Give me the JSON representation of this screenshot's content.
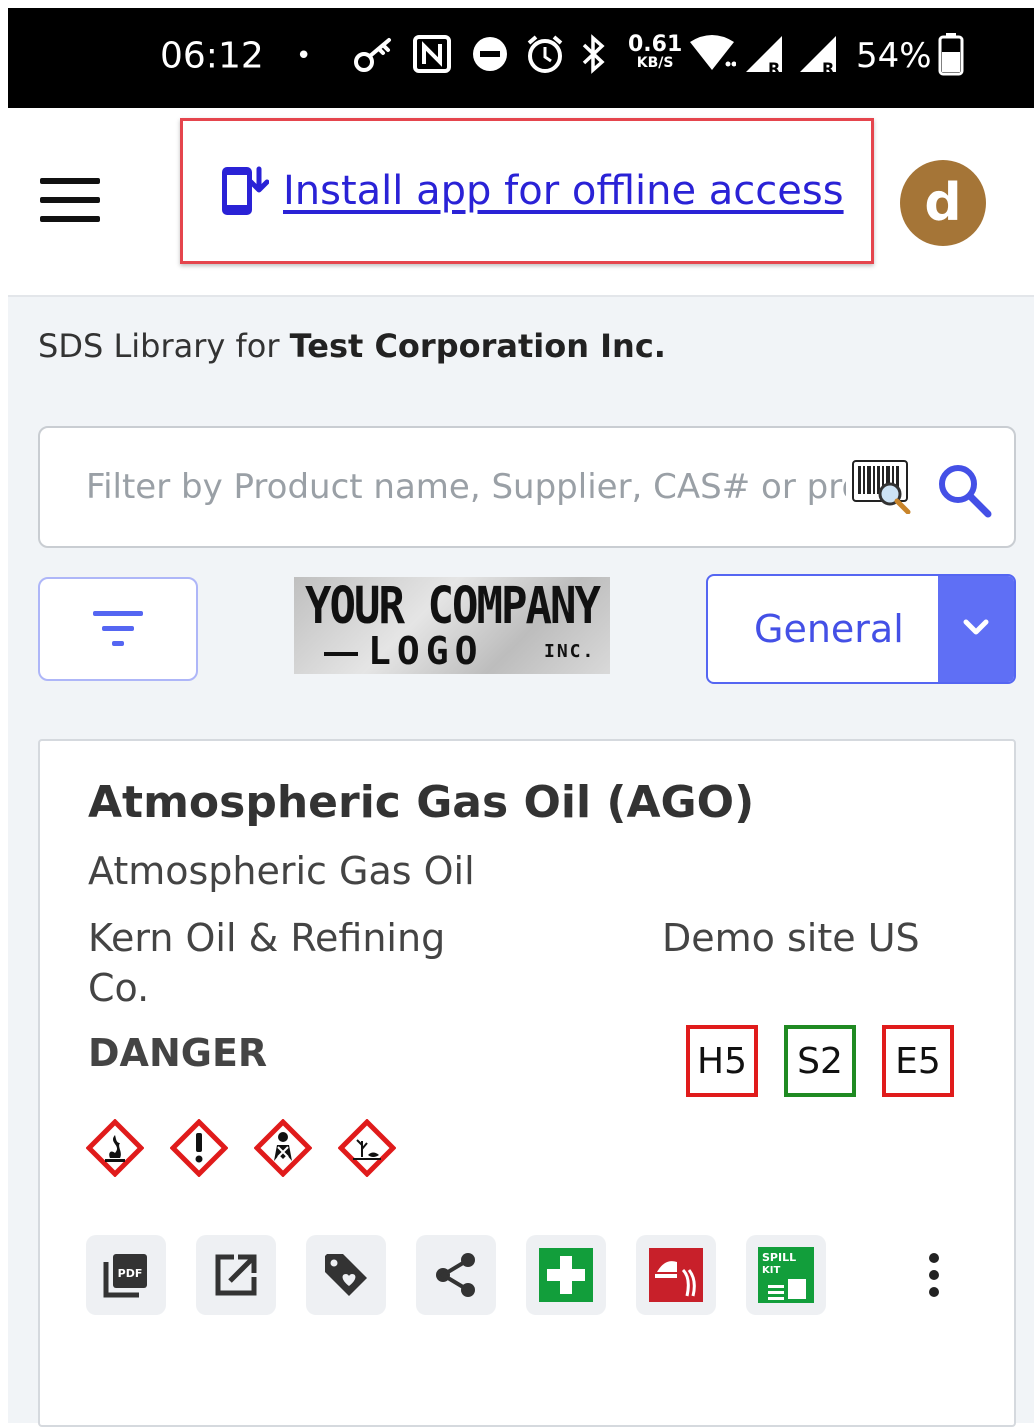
{
  "status_bar": {
    "time": "06:12",
    "dot": "•",
    "speed_value": "0.61",
    "speed_unit": "KB/S",
    "battery_percent": "54%",
    "icons": [
      "key-icon",
      "nfc-icon",
      "do-not-disturb-icon",
      "alarm-icon",
      "bluetooth-icon",
      "wifi-icon",
      "signal-r-icon",
      "signal-r-icon",
      "battery-icon"
    ]
  },
  "header": {
    "install_label": "Install app for offline access",
    "avatar_letter": "d",
    "install_box_color": "#e5454d",
    "link_color": "#2a22d6",
    "avatar_color": "#a57537"
  },
  "library": {
    "prefix": "SDS Library for ",
    "company": "Test Corporation Inc."
  },
  "search": {
    "placeholder": "Filter by Product name, Supplier, CAS# or product code"
  },
  "toolbar": {
    "logo_line1": "YOUR COMPANY",
    "logo_line2": "LOGO",
    "logo_inc": "INC.",
    "view_select": "General",
    "accent": "#5566f2"
  },
  "product": {
    "title": "Atmospheric Gas Oil (AGO)",
    "subtitle": "Atmospheric Gas Oil",
    "supplier": "Kern Oil & Refining Co.",
    "site": "Demo site US",
    "signal_word": "DANGER",
    "ratings": [
      {
        "label": "H5",
        "color": "#e01b1b"
      },
      {
        "label": "S2",
        "color": "#1f8a22"
      },
      {
        "label": "E5",
        "color": "#e01b1b"
      }
    ],
    "pictograms": [
      "flame-pictogram-icon",
      "exclamation-pictogram-icon",
      "health-hazard-pictogram-icon",
      "environment-pictogram-icon"
    ],
    "actions": {
      "pdf_label": "PDF",
      "spill_label_1": "SPILL",
      "spill_label_2": "KIT",
      "icons": [
        "pdf-icon",
        "open-external-icon",
        "tag-icon",
        "share-icon",
        "first-aid-icon",
        "firefighting-icon",
        "spill-kit-icon",
        "more-vertical-icon"
      ]
    }
  }
}
